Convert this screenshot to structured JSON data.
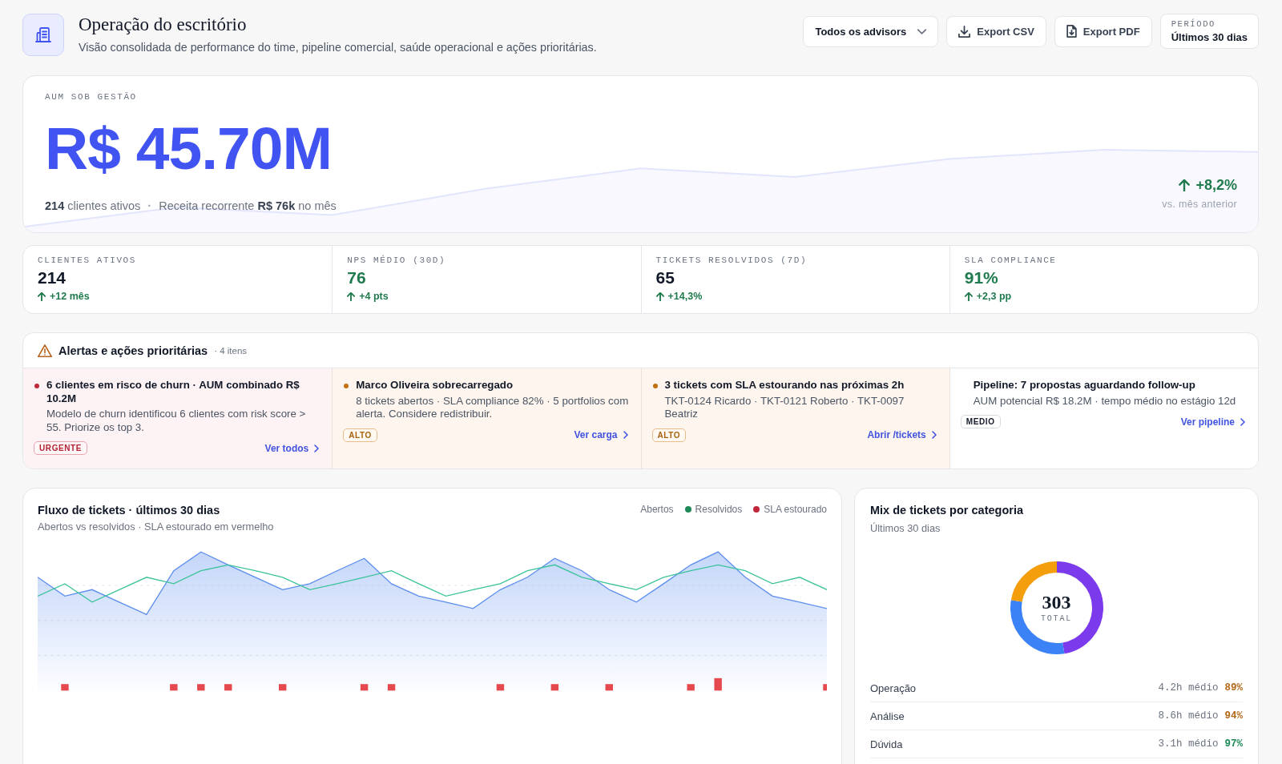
{
  "header": {
    "title": "Operação do escritório",
    "subtitle": "Visão consolidada de performance do time, pipeline comercial, saúde operacional e ações prioritárias.",
    "advisor_filter": {
      "value": "Todos os advisors"
    },
    "actions": [
      {
        "kind": "csv",
        "label": "Export CSV"
      },
      {
        "kind": "pdf",
        "label": "Export PDF"
      }
    ],
    "period": {
      "label": "PERÍODO",
      "value": "Últimos 30 dias"
    }
  },
  "aum": {
    "label": "AUM SOB GESTÃO",
    "value": "R$ 45.70M",
    "stats": [
      "**214** clientes ativos",
      "Receita recorrente **R$ 76k** no mês"
    ],
    "separator": "·",
    "change": {
      "rising": true,
      "value": "+8,2%",
      "caption": "vs. mês anterior"
    }
  },
  "kpis": [
    {
      "label": "CLIENTES ATIVOS",
      "value": "214",
      "highlight": false,
      "rising": true,
      "delta": "+12 mês"
    },
    {
      "label": "NPS MÉDIO (30D)",
      "value": "76",
      "highlight": true,
      "rising": true,
      "delta": "+4 pts"
    },
    {
      "label": "TICKETS RESOLVIDOS (7D)",
      "value": "65",
      "highlight": false,
      "rising": true,
      "delta": "+14,3%"
    },
    {
      "label": "SLA COMPLIANCE",
      "value": "91%",
      "highlight": true,
      "rising": true,
      "delta": "+2,3 pp"
    }
  ],
  "alerts": {
    "title": "Alertas e ações prioritárias",
    "count": "· 4 itens",
    "items": [
      {
        "kind": "urgent",
        "title": "6 clientes em risco de churn · AUM combinado R$ 10.2M",
        "description": "Modelo de churn identificou 6 clientes com risk score > 55. Priorize os top 3.",
        "badge": "URGENTE",
        "link": "Ver todos"
      },
      {
        "kind": "high",
        "title": "Marco Oliveira sobrecarregado",
        "description": "8 tickets abertos · SLA compliance 82% · 5 portfolios com alerta. Considere redistribuir.",
        "badge": "ALTO",
        "link": "Ver carga"
      },
      {
        "kind": "high",
        "title": "3 tickets com SLA estourando nas próximas 2h",
        "description": "TKT-0124 Ricardo · TKT-0121 Roberto · TKT-0097 Beatriz",
        "badge": "ALTO",
        "link": "Abrir /tickets"
      },
      {
        "kind": "medium",
        "title": "Pipeline: 7 propostas aguardando follow-up",
        "description": "AUM potencial R$ 18.2M · tempo médio no estágio 12d",
        "badge": "MEDIO",
        "link": "Ver pipeline"
      }
    ]
  },
  "ticket_flow": {
    "title": "Fluxo de tickets · últimos 30 dias",
    "subtitle": "Abertos vs resolvidos · SLA estourado em vermelho",
    "legend": [
      {
        "label": "Abertos"
      },
      {
        "label": "Resolvidos",
        "color": "#1f8a57"
      },
      {
        "label": "SLA estourado",
        "color": "#c0263a"
      }
    ]
  },
  "category_mix": {
    "title": "Mix de tickets por categoria",
    "subtitle": "Últimos 30 dias",
    "total": "303",
    "total_label": "TOTAL",
    "rows": [
      {
        "category": "Operação",
        "average": "4.2h médio",
        "rate": "89%",
        "color": "#b4691a"
      },
      {
        "category": "Análise",
        "average": "8.6h médio",
        "rate": "94%",
        "color": "#b4691a"
      },
      {
        "category": "Dúvida",
        "average": "3.1h médio",
        "rate": "97%",
        "color": "#1f8a57"
      }
    ]
  }
}
